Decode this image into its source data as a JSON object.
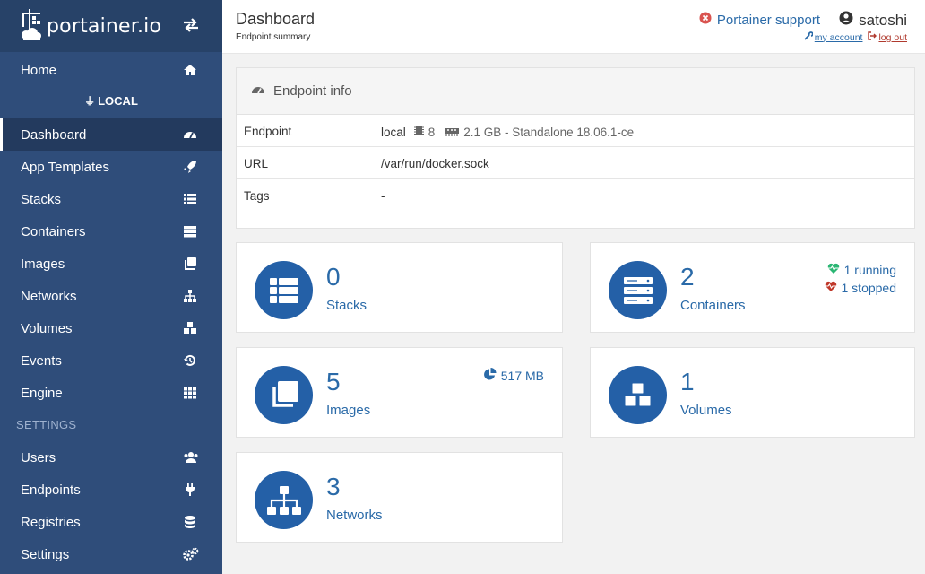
{
  "brand": {
    "name": "portainer.io"
  },
  "sidebar": {
    "top_items": [
      {
        "label": "Home",
        "icon": "home-icon"
      }
    ],
    "endpoint_label": "LOCAL",
    "endpoint_items": [
      {
        "label": "Dashboard",
        "icon": "dashboard-icon",
        "active": true
      },
      {
        "label": "App Templates",
        "icon": "rocket-icon"
      },
      {
        "label": "Stacks",
        "icon": "list-icon"
      },
      {
        "label": "Containers",
        "icon": "server-icon"
      },
      {
        "label": "Images",
        "icon": "clone-icon"
      },
      {
        "label": "Networks",
        "icon": "sitemap-icon"
      },
      {
        "label": "Volumes",
        "icon": "cubes-icon"
      },
      {
        "label": "Events",
        "icon": "history-icon"
      },
      {
        "label": "Engine",
        "icon": "th-icon"
      }
    ],
    "settings_label": "SETTINGS",
    "settings_items": [
      {
        "label": "Users",
        "icon": "users-icon"
      },
      {
        "label": "Endpoints",
        "icon": "plug-icon"
      },
      {
        "label": "Registries",
        "icon": "database-icon"
      },
      {
        "label": "Settings",
        "icon": "cogs-icon"
      }
    ]
  },
  "header": {
    "title": "Dashboard",
    "subtitle": "Endpoint summary",
    "support_label": "Portainer support",
    "username": "satoshi",
    "my_account": "my account",
    "log_out": "log out"
  },
  "endpoint_info": {
    "title": "Endpoint info",
    "rows": [
      {
        "key": "Endpoint",
        "name": "local",
        "cpu": "8",
        "memory": "2.1 GB - Standalone 18.06.1-ce"
      },
      {
        "key": "URL",
        "value": "/var/run/docker.sock"
      },
      {
        "key": "Tags",
        "value": "-"
      }
    ]
  },
  "widgets": {
    "stacks": {
      "count": "0",
      "label": "Stacks"
    },
    "containers": {
      "count": "2",
      "label": "Containers",
      "running": "1 running",
      "stopped": "1 stopped"
    },
    "images": {
      "count": "5",
      "label": "Images",
      "size": "517 MB"
    },
    "volumes": {
      "count": "1",
      "label": "Volumes"
    },
    "networks": {
      "count": "3",
      "label": "Networks"
    }
  },
  "colors": {
    "sidebar_bg": "#2f4d7a",
    "accent": "#2a6aa8",
    "widget_circle": "#2460a7",
    "running": "#2bb673",
    "stopped": "#c0392b"
  }
}
